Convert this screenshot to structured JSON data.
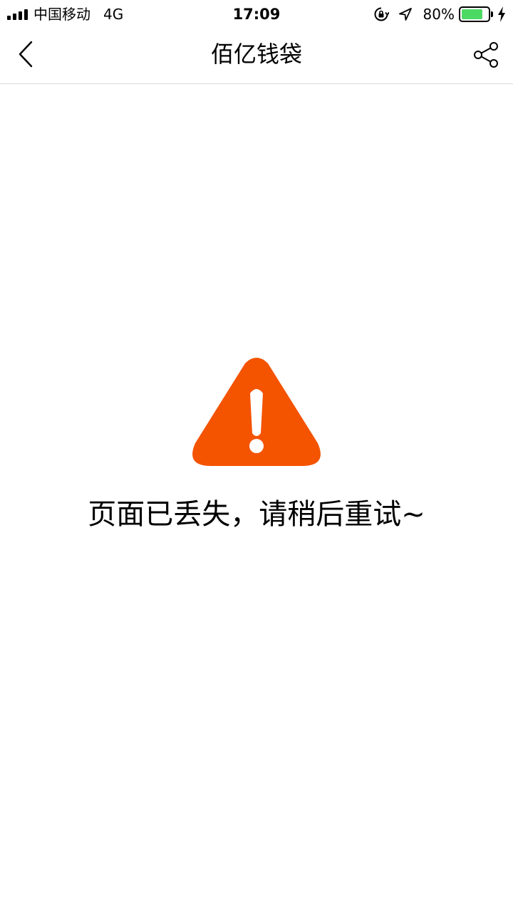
{
  "status_bar": {
    "carrier": "中国移动",
    "network": "4G",
    "time": "17:09",
    "battery_percent": "80%",
    "battery_level": 0.8,
    "battery_color": "#4cd964",
    "icons": [
      "signal-icon",
      "lock-rotation-icon",
      "location-icon",
      "battery-icon",
      "charging-icon"
    ]
  },
  "nav": {
    "title": "佰亿钱袋",
    "back_icon": "chevron-left-icon",
    "share_icon": "share-icon"
  },
  "main": {
    "warning_icon": "warning-icon",
    "warning_color": "#f45300",
    "message": "页面已丢失，请稍后重试~"
  }
}
